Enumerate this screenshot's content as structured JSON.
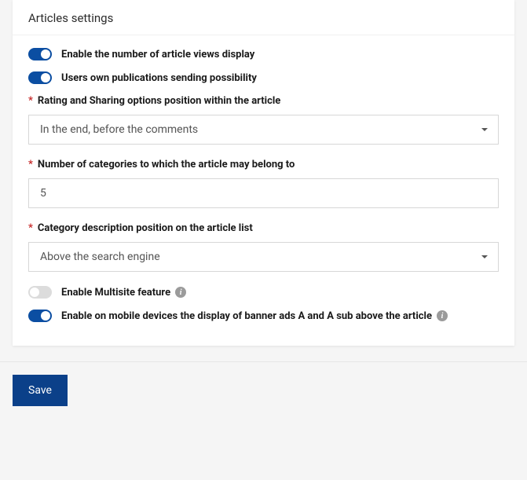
{
  "panel": {
    "title": "Articles settings"
  },
  "settings": {
    "toggle_views": {
      "label": "Enable the number of article views display",
      "on": true
    },
    "toggle_user_publications": {
      "label": "Users own publications sending possibility",
      "on": true
    },
    "rating_position": {
      "label": "Rating and Sharing options position within the article",
      "value": "In the end, before the comments"
    },
    "categories_count": {
      "label": "Number of categories to which the article may belong to",
      "value": "5"
    },
    "desc_position": {
      "label": "Category description position on the article list",
      "value": "Above the search engine"
    },
    "toggle_multisite": {
      "label": "Enable Multisite feature",
      "on": false
    },
    "toggle_mobile_banner": {
      "label": "Enable on mobile devices the display of banner ads A and A sub above the article",
      "on": true
    }
  },
  "footer": {
    "save": "Save"
  }
}
